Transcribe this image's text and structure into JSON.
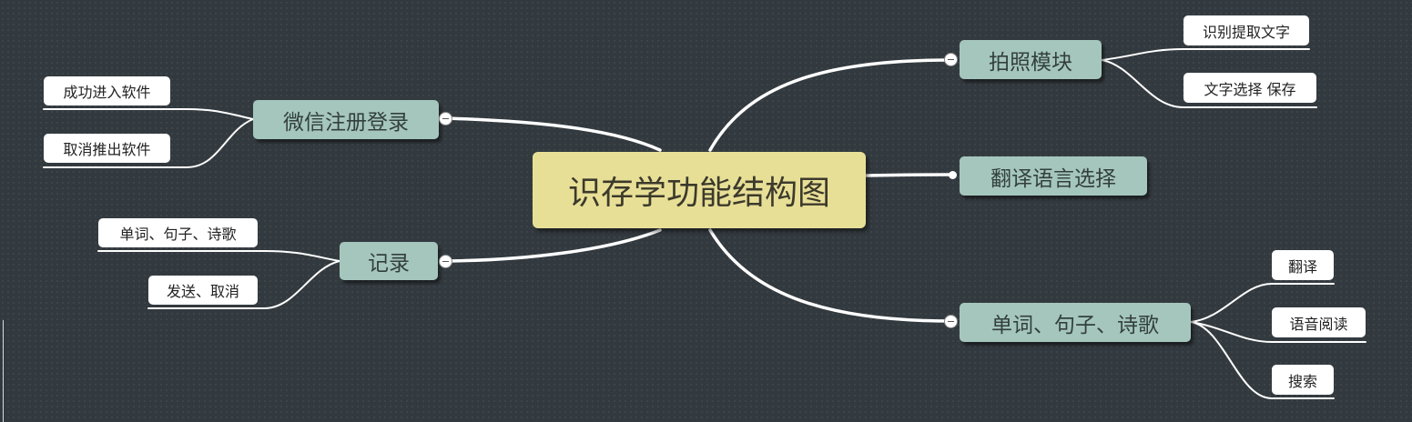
{
  "root": {
    "label": "识存学功能结构图"
  },
  "branches": {
    "wechat": {
      "label": "微信注册登录",
      "children": [
        "成功进入软件",
        "取消推出软件"
      ]
    },
    "record": {
      "label": "记录",
      "children": [
        "单词、句子、诗歌",
        "发送、取消"
      ]
    },
    "photo": {
      "label": "拍照模块",
      "children": [
        "识别提取文字",
        "文字选择 保存"
      ]
    },
    "translate_lang": {
      "label": "翻译语言选择"
    },
    "words": {
      "label": "单词、句子、诗歌",
      "children": [
        "翻译",
        "语音阅读",
        "搜索"
      ]
    }
  },
  "colors": {
    "background": "#333a3f",
    "root": "#e8df97",
    "main_topic": "#a5c6bc",
    "subtopic": "#ffffff",
    "connector": "#ffffff"
  },
  "icons": {
    "collapse": "collapse-minus-icon",
    "attach": "connector-dot-icon"
  }
}
